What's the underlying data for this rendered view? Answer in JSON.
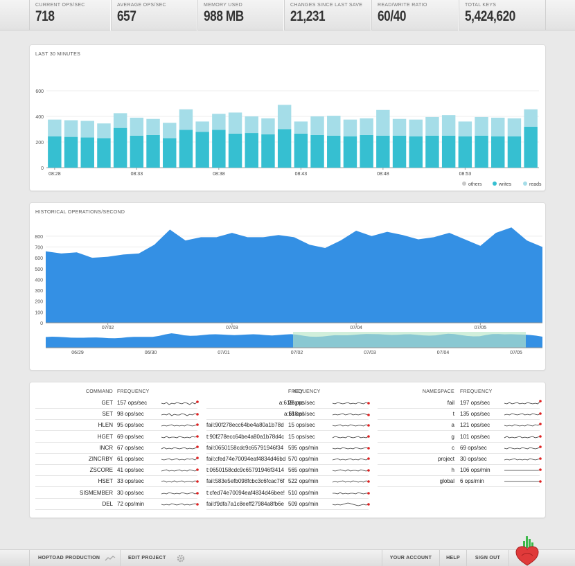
{
  "stats": [
    {
      "label": "CURRENT OPS/SEC",
      "value": "718"
    },
    {
      "label": "AVERAGE OPS/SEC",
      "value": "657"
    },
    {
      "label": "MEMORY USED",
      "value": "988 MB"
    },
    {
      "label": "CHANGES SINCE LAST SAVE",
      "value": "21,231"
    },
    {
      "label": "READ/WRITE RATIO",
      "value": "60/40"
    },
    {
      "label": "TOTAL KEYS",
      "value": "5,424,620"
    }
  ],
  "panel1": {
    "title": "LAST 30 MINUTES"
  },
  "panel2": {
    "title": "HISTORICAL OPERATIONS/SECOND"
  },
  "colors": {
    "writes": "#36bfd1",
    "reads": "#a5dde8",
    "others": "#c8c8c8",
    "area": "#3490e4",
    "selection": "#b8e6c8",
    "spark_dot": "#e02020",
    "logo_red": "#e03a3a",
    "logo_green": "#3db84a"
  },
  "chart_data": [
    {
      "type": "bar",
      "title": "LAST 30 MINUTES",
      "stacked": true,
      "categories": [
        "08:28",
        "08:29",
        "08:30",
        "08:31",
        "08:32",
        "08:33",
        "08:34",
        "08:35",
        "08:36",
        "08:37",
        "08:38",
        "08:39",
        "08:40",
        "08:41",
        "08:42",
        "08:43",
        "08:44",
        "08:45",
        "08:46",
        "08:47",
        "08:48",
        "08:49",
        "08:50",
        "08:51",
        "08:52",
        "08:53",
        "08:54",
        "08:55",
        "08:56",
        "08:57"
      ],
      "tick_labels": [
        "08:28",
        "08:33",
        "08:38",
        "08:43",
        "08:48",
        "08:53"
      ],
      "series": [
        {
          "name": "others",
          "values": [
            0,
            0,
            0,
            0,
            0,
            0,
            0,
            0,
            0,
            0,
            0,
            0,
            0,
            0,
            0,
            0,
            0,
            0,
            0,
            0,
            0,
            0,
            0,
            0,
            0,
            0,
            0,
            0,
            0,
            0
          ]
        },
        {
          "name": "writes",
          "values": [
            245,
            240,
            235,
            230,
            310,
            250,
            255,
            230,
            295,
            280,
            295,
            265,
            270,
            260,
            300,
            265,
            255,
            250,
            245,
            255,
            250,
            250,
            245,
            250,
            250,
            245,
            250,
            245,
            245,
            320
          ]
        },
        {
          "name": "reads",
          "values": [
            130,
            130,
            130,
            115,
            115,
            140,
            125,
            120,
            160,
            80,
            125,
            165,
            130,
            125,
            190,
            95,
            145,
            155,
            130,
            130,
            200,
            130,
            130,
            145,
            160,
            115,
            145,
            145,
            140,
            135
          ]
        }
      ],
      "ylim": [
        0,
        600
      ],
      "yticks": [
        0,
        200,
        400,
        600
      ],
      "legend": "bottom-right"
    },
    {
      "type": "area",
      "title": "HISTORICAL OPERATIONS/SECOND",
      "x": [
        "07/01 12:00",
        "07/01 15:00",
        "07/01 18:00",
        "07/01 21:00",
        "07/02 00:00",
        "07/02 03:00",
        "07/02 06:00",
        "07/02 09:00",
        "07/02 12:00",
        "07/02 15:00",
        "07/02 18:00",
        "07/02 21:00",
        "07/03 00:00",
        "07/03 03:00",
        "07/03 06:00",
        "07/03 09:00",
        "07/03 12:00",
        "07/03 15:00",
        "07/03 18:00",
        "07/03 21:00",
        "07/04 00:00",
        "07/04 03:00",
        "07/04 06:00",
        "07/04 09:00",
        "07/04 12:00",
        "07/04 15:00",
        "07/04 18:00",
        "07/04 21:00",
        "07/05 00:00",
        "07/05 03:00",
        "07/05 06:00",
        "07/05 09:00",
        "07/05 12:00"
      ],
      "values": [
        660,
        640,
        650,
        600,
        610,
        630,
        640,
        720,
        860,
        760,
        790,
        790,
        830,
        790,
        790,
        810,
        790,
        720,
        690,
        760,
        850,
        800,
        840,
        810,
        770,
        790,
        830,
        770,
        710,
        830,
        880,
        760,
        700
      ],
      "tick_labels": [
        "07/02",
        "07/03",
        "07/04",
        "07/05"
      ],
      "ylim": [
        0,
        850
      ],
      "yticks": [
        0,
        100,
        200,
        300,
        400,
        500,
        600,
        700,
        800
      ],
      "overview_tick_labels": [
        "06/29",
        "06/30",
        "07/01",
        "07/02",
        "07/03",
        "07/04",
        "07/05"
      ]
    }
  ],
  "tables": [
    {
      "header_name": "COMMAND",
      "header_freq": "FREQUENCY",
      "rows": [
        {
          "name": "GET",
          "freq": "157 ops/sec",
          "spark": [
            5,
            4,
            6,
            3,
            5,
            4,
            6,
            5,
            4,
            6,
            5,
            3,
            6,
            4,
            7
          ]
        },
        {
          "name": "SET",
          "freq": "98 ops/sec",
          "spark": [
            4,
            5,
            4,
            6,
            3,
            5,
            4,
            4,
            6,
            5,
            3,
            5,
            4,
            6,
            5
          ]
        },
        {
          "name": "HLEN",
          "freq": "95 ops/sec",
          "spark": [
            4,
            5,
            4,
            5,
            6,
            4,
            5,
            4,
            5,
            4,
            6,
            5,
            4,
            5,
            6
          ]
        },
        {
          "name": "HGET",
          "freq": "69 ops/sec",
          "spark": [
            5,
            4,
            6,
            4,
            5,
            5,
            4,
            6,
            5,
            4,
            5,
            4,
            6,
            5,
            6
          ]
        },
        {
          "name": "INCR",
          "freq": "67 ops/sec",
          "spark": [
            4,
            6,
            4,
            5,
            4,
            6,
            5,
            4,
            5,
            6,
            4,
            5,
            4,
            5,
            7
          ]
        },
        {
          "name": "ZINCRBY",
          "freq": "61 ops/sec",
          "spark": [
            5,
            4,
            5,
            6,
            4,
            5,
            6,
            4,
            5,
            4,
            6,
            5,
            6,
            4,
            7
          ]
        },
        {
          "name": "ZSCORE",
          "freq": "41 ops/sec",
          "spark": [
            4,
            5,
            6,
            4,
            5,
            4,
            5,
            6,
            4,
            5,
            4,
            6,
            5,
            4,
            6
          ]
        },
        {
          "name": "HSET",
          "freq": "33 ops/sec",
          "spark": [
            5,
            6,
            4,
            5,
            4,
            6,
            4,
            5,
            6,
            4,
            5,
            5,
            4,
            6,
            5
          ]
        },
        {
          "name": "SISMEMBER",
          "freq": "30 ops/sec",
          "spark": [
            4,
            5,
            4,
            6,
            5,
            4,
            5,
            4,
            6,
            5,
            4,
            5,
            6,
            4,
            5
          ]
        },
        {
          "name": "DEL",
          "freq": "72 ops/min",
          "spark": [
            5,
            4,
            5,
            4,
            6,
            5,
            4,
            5,
            6,
            4,
            5,
            4,
            5,
            6,
            5
          ]
        }
      ]
    },
    {
      "header_name": "KEY",
      "header_freq": "FREQUENCY",
      "rows": [
        {
          "name": "a:618:gnc",
          "freq": "28 ops/sec",
          "spark": [
            5,
            4,
            6,
            5,
            4,
            5,
            6,
            4,
            5,
            4,
            6,
            5,
            4,
            6,
            5
          ]
        },
        {
          "name": "a:618:sl",
          "freq": "18 ops/sec",
          "spark": [
            4,
            5,
            4,
            5,
            6,
            4,
            5,
            6,
            4,
            5,
            4,
            5,
            6,
            5,
            4
          ]
        },
        {
          "name": "fail:90f278ecc64be4a80a1b78d",
          "freq": "15 ops/sec",
          "spark": [
            5,
            4,
            5,
            6,
            4,
            5,
            4,
            6,
            5,
            4,
            5,
            5,
            4,
            6,
            5
          ]
        },
        {
          "name": "t:90f278ecc64be4a80a1b78d4c",
          "freq": "15 ops/sec",
          "spark": [
            4,
            6,
            5,
            4,
            5,
            4,
            6,
            5,
            4,
            5,
            6,
            4,
            5,
            4,
            6
          ]
        },
        {
          "name": "fail:0650158cdc9c65791946f34",
          "freq": "595 ops/min",
          "spark": [
            5,
            4,
            5,
            4,
            6,
            5,
            4,
            5,
            4,
            6,
            5,
            4,
            5,
            6,
            5
          ]
        },
        {
          "name": "fail:cfed74e70094eaf4834d46bd",
          "freq": "570 ops/min",
          "spark": [
            4,
            5,
            6,
            4,
            5,
            4,
            5,
            6,
            4,
            5,
            4,
            6,
            5,
            4,
            6
          ]
        },
        {
          "name": "t:0650158cdc9c65791946f3414",
          "freq": "565 ops/min",
          "spark": [
            5,
            4,
            5,
            6,
            5,
            4,
            6,
            4,
            5,
            5,
            4,
            6,
            5,
            4,
            5
          ]
        },
        {
          "name": "fail:583e5efb098fcbc3c6fcac76f",
          "freq": "522 ops/min",
          "spark": [
            4,
            5,
            4,
            5,
            6,
            4,
            5,
            4,
            6,
            5,
            4,
            5,
            4,
            6,
            5
          ]
        },
        {
          "name": "t:cfed74e70094eaf4834d46bee!",
          "freq": "510 ops/min",
          "spark": [
            5,
            5,
            4,
            6,
            4,
            5,
            4,
            5,
            5,
            4,
            6,
            5,
            4,
            5,
            5
          ]
        },
        {
          "name": "fail:f9dfa7a1c8eeff27984a8fb6e",
          "freq": "509 ops/min",
          "spark": [
            5,
            4,
            5,
            4,
            5,
            6,
            7,
            6,
            5,
            4,
            3,
            4,
            5,
            4,
            5
          ]
        }
      ]
    },
    {
      "header_name": "NAMESPACE",
      "header_freq": "FREQUENCY",
      "rows": [
        {
          "name": "fail",
          "freq": "197 ops/sec",
          "spark": [
            5,
            4,
            6,
            4,
            5,
            6,
            4,
            5,
            4,
            6,
            5,
            4,
            5,
            4,
            8
          ]
        },
        {
          "name": "t",
          "freq": "135 ops/sec",
          "spark": [
            4,
            5,
            4,
            6,
            5,
            4,
            5,
            6,
            4,
            5,
            4,
            6,
            5,
            4,
            6
          ]
        },
        {
          "name": "a",
          "freq": "121 ops/sec",
          "spark": [
            5,
            4,
            5,
            4,
            6,
            5,
            4,
            5,
            4,
            6,
            5,
            4,
            6,
            5,
            7
          ]
        },
        {
          "name": "g",
          "freq": "101 ops/sec",
          "spark": [
            4,
            6,
            4,
            5,
            4,
            5,
            6,
            4,
            5,
            4,
            5,
            6,
            4,
            5,
            6
          ]
        },
        {
          "name": "c",
          "freq": "69 ops/sec",
          "spark": [
            5,
            4,
            6,
            5,
            4,
            5,
            4,
            6,
            5,
            4,
            6,
            5,
            4,
            5,
            7
          ]
        },
        {
          "name": "project",
          "freq": "30 ops/sec",
          "spark": [
            4,
            5,
            4,
            5,
            6,
            4,
            5,
            4,
            5,
            4,
            6,
            5,
            4,
            5,
            6
          ]
        },
        {
          "name": "h",
          "freq": "106 ops/min",
          "spark": [
            5,
            5,
            5,
            5,
            5,
            5,
            5,
            5,
            5,
            5,
            5,
            5,
            5,
            5,
            6
          ]
        },
        {
          "name": "global",
          "freq": "6 ops/min",
          "spark": [
            5,
            5,
            5,
            5,
            5,
            5,
            5,
            5,
            5,
            5,
            5,
            5,
            5,
            5,
            5
          ]
        }
      ]
    }
  ],
  "footer": {
    "project": "HOPTOAD PRODUCTION",
    "edit": "EDIT PROJECT",
    "account": "YOUR ACCOUNT",
    "help": "HELP",
    "signout": "SIGN OUT"
  }
}
